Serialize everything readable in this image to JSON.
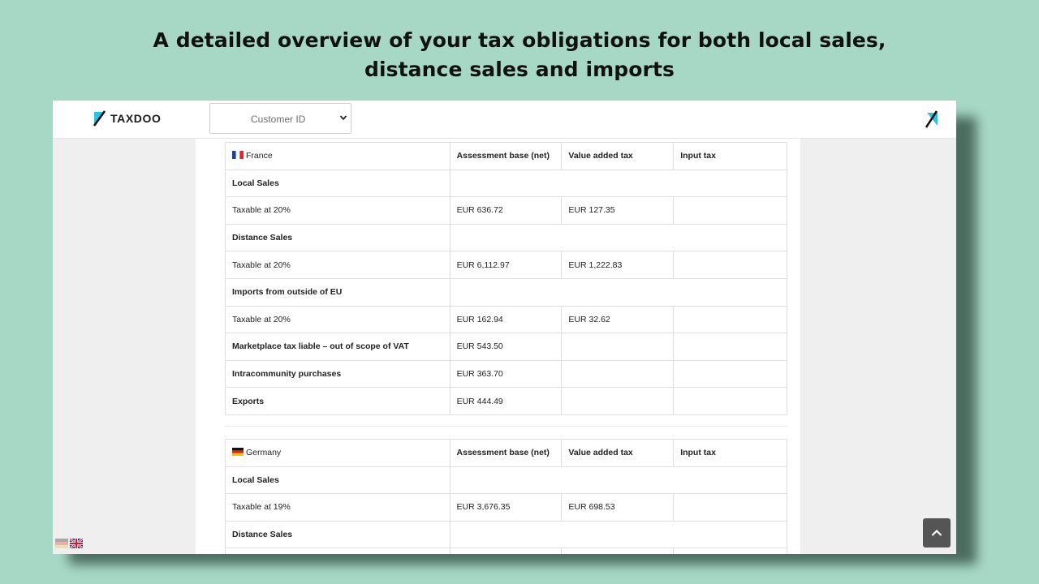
{
  "headline": {
    "line1": "A detailed overview of your tax obligations for both local sales,",
    "line2": "distance sales and imports"
  },
  "app": {
    "logo_text": "TAXDOO",
    "customer_select_placeholder": "Customer ID",
    "icons": [
      "taxdoo-logo-icon",
      "chevron-down-icon",
      "taxdoo-mark-icon",
      "flag-de-icon",
      "flag-uk-icon",
      "chevron-up-icon"
    ]
  },
  "france": {
    "country": "France",
    "headers": {
      "base": "Assessment base (net)",
      "vat": "Value added tax",
      "input": "Input tax"
    },
    "rows": {
      "local_sales": "Local Sales",
      "local_taxable": "Taxable at 20%",
      "local_base": "EUR 636.72",
      "local_vat": "EUR 127.35",
      "distance_sales": "Distance Sales",
      "distance_taxable": "Taxable at 20%",
      "distance_base": "EUR 6,112.97",
      "distance_vat": "EUR 1,222.83",
      "imports": "Imports from outside of EU",
      "imports_taxable": "Taxable at 20%",
      "imports_base": "EUR 162.94",
      "imports_vat": "EUR 32.62",
      "marketplace": "Marketplace tax liable – out of scope of VAT",
      "marketplace_base": "EUR 543.50",
      "intracommunity": "Intracommunity purchases",
      "intracommunity_base": "EUR 363.70",
      "exports": "Exports",
      "exports_base": "EUR 444.49"
    }
  },
  "germany": {
    "country": "Germany",
    "headers": {
      "base": "Assessment base (net)",
      "vat": "Value added tax",
      "input": "Input tax"
    },
    "rows": {
      "local_sales": "Local Sales",
      "local_taxable": "Taxable at 19%",
      "local_base": "EUR 3,676.35",
      "local_vat": "EUR 698.53",
      "distance_sales": "Distance Sales"
    }
  }
}
